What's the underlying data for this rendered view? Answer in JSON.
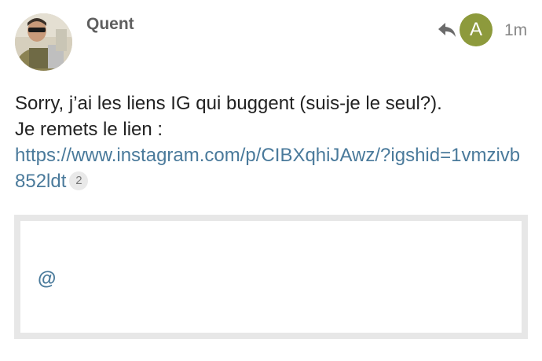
{
  "post": {
    "username": "Quent",
    "age": "1m",
    "reply_to_initial": "A",
    "body_line1": "Sorry, j’ai les liens IG qui buggent (suis-je le seul?).",
    "body_line2": "Je remets le lien :",
    "link_text": "https://www.instagram.com/p/CIBXqhiJAwz/?igshid=1vmzivb852ldt",
    "link_clicks": "2"
  },
  "composer": {
    "text": "@"
  },
  "icons": {
    "reply": "reply-arrow-icon",
    "avatar": "user-avatar-photo"
  },
  "colors": {
    "reply_avatar_bg": "#8d9a3c",
    "link": "#4a7a9b",
    "username": "#5f5f5f",
    "composer_border": "#e7e7e7"
  }
}
